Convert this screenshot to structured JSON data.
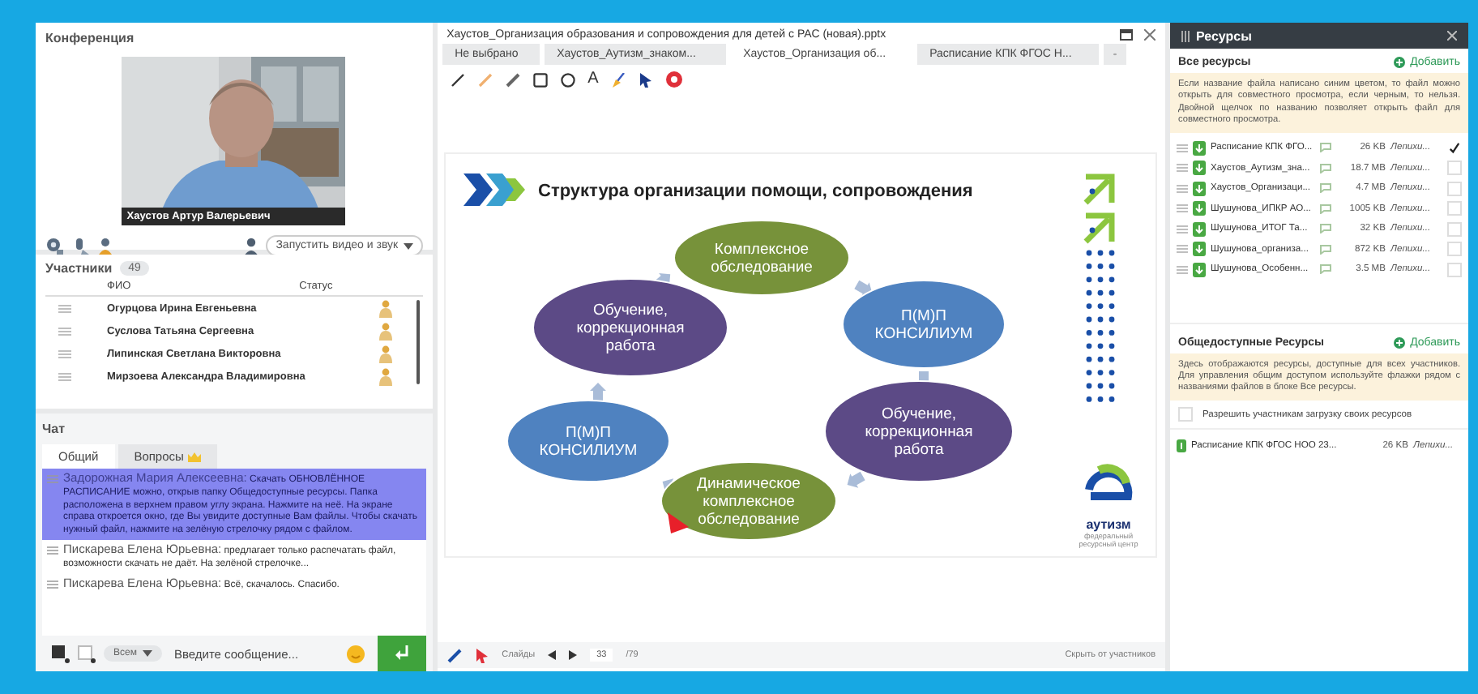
{
  "conference": {
    "title": "Конференция",
    "video": {
      "kind": "picture",
      "caption": "Хаустов Артур Валерьевич"
    },
    "start_button": "Запустить видео и звук"
  },
  "participants": {
    "title": "Участники",
    "count": "49",
    "columns": [
      "ФИО",
      "Статус"
    ],
    "rows": [
      {
        "name": "Огурцова Ирина  Евгеньевна"
      },
      {
        "name": "Суслова Татьяна Сергеевна"
      },
      {
        "name": "Липинская Светлана Викторовна"
      },
      {
        "name": "Мирзоева Александра  Владимировна"
      }
    ]
  },
  "chat": {
    "title": "Чат",
    "tabs": [
      {
        "label": "Общий",
        "selected": true
      },
      {
        "label": "Вопросы",
        "selected": false
      }
    ],
    "messages": [
      {
        "author": "Задорожная Мария Алексеевна:",
        "text": "Скачать ОБНОВЛЁННОЕ РАСПИСАНИЕ можно, открыв папку Общедоступные ресурсы. Папка расположена в верхнем правом углу экрана. Нажмите на неё. На экране справа откроется окно, где Вы увидите доступные Вам файлы. Чтобы скачать нужный файл, нажмите на зелёную стрелочку рядом с файлом.",
        "highlighted": true
      },
      {
        "author": "Пискарева Елена  Юрьевна:",
        "text": "предлагает только распечатать файл, возможности скачать не даёт. На зелёной стрелочке...",
        "highlighted": false
      },
      {
        "author": "Пискарева Елена  Юрьевна:",
        "text": "Всё, скачалось. Спасибо.",
        "highlighted": false
      }
    ],
    "recipient": "Всем",
    "placeholder": "Введите сообщение..."
  },
  "document": {
    "title": "Хаустов_Организация образования и сопровождения для детей с РАС (новая).pptx",
    "tabs": [
      {
        "label": "Не выбрано",
        "selected": false
      },
      {
        "label": "Хаустов_Аутизм_знаком...",
        "selected": false
      },
      {
        "label": "Хаустов_Организация об...",
        "selected": true
      },
      {
        "label": "Расписание КПК ФГОС Н...",
        "selected": false
      }
    ],
    "text_tool": "A",
    "slide": {
      "title": "Структура организации помощи, сопровождения",
      "nodes": [
        {
          "lines": [
            "Комплексное",
            "обследование"
          ],
          "color": "#77923a"
        },
        {
          "lines": [
            "Обучение,",
            "коррекционная",
            "работа"
          ],
          "color": "#5c4a86"
        },
        {
          "lines": [
            "П(М)П",
            "КОНСИЛИУМ"
          ],
          "color": "#4f82c0"
        },
        {
          "lines": [
            "П(М)П",
            "КОНСИЛИУМ"
          ],
          "color": "#4f82c0"
        },
        {
          "lines": [
            "Обучение,",
            "коррекционная",
            "работа"
          ],
          "color": "#5c4a86"
        },
        {
          "lines": [
            "Динамическое",
            "комплексное",
            "обследование"
          ],
          "color": "#77923a"
        }
      ],
      "logo_text": "аутизм",
      "logo_subtitle": [
        "федеральный",
        "ресурсный центр"
      ]
    },
    "footer": {
      "slides_label": "Слайды",
      "page": "33",
      "total": "/79",
      "hide": "Скрыть от участников"
    }
  },
  "resources": {
    "title": "Ресурсы",
    "all": {
      "title": "Все ресурсы",
      "add": "Добавить",
      "info": "Если название файла написано синим цветом, то файл можно открыть для совместного просмотра, если черным, то нельзя. Двойной щелчок по названию позволяет открыть файл для совместного просмотра.",
      "files": [
        {
          "name": "Расписание КПК ФГО...",
          "size": "26 KB",
          "owner": "Лепихи...",
          "checked": true
        },
        {
          "name": "Хаустов_Аутизм_зна...",
          "size": "18.7 MB",
          "owner": "Лепихи...",
          "checked": false
        },
        {
          "name": "Хаустов_Организаци...",
          "size": "4.7 MB",
          "owner": "Лепихи...",
          "checked": false
        },
        {
          "name": "Шушунова_ИПКР АО...",
          "size": "1005 KB",
          "owner": "Лепихи...",
          "checked": false
        },
        {
          "name": "Шушунова_ИТОГ Та...",
          "size": "32 KB",
          "owner": "Лепихи...",
          "checked": false
        },
        {
          "name": "Шушунова_организа...",
          "size": "872 KB",
          "owner": "Лепихи...",
          "checked": false
        },
        {
          "name": "Шушунова_Особенн...",
          "size": "3.5 MB",
          "owner": "Лепихи...",
          "checked": false
        }
      ]
    },
    "public": {
      "title": "Общедоступные Ресурсы",
      "add": "Добавить",
      "info": "Здесь отображаются ресурсы, доступные для всех участников. Для управления общим доступом используйте флажки рядом с названиями файлов в блоке Все ресурсы.",
      "allow_upload": {
        "label": "Разрешить участникам загрузку своих ресурсов",
        "checked": false
      },
      "files": [
        {
          "name": "Расписание КПК ФГОС НОО 23...",
          "size": "26 KB",
          "owner": "Лепихи..."
        }
      ]
    }
  }
}
